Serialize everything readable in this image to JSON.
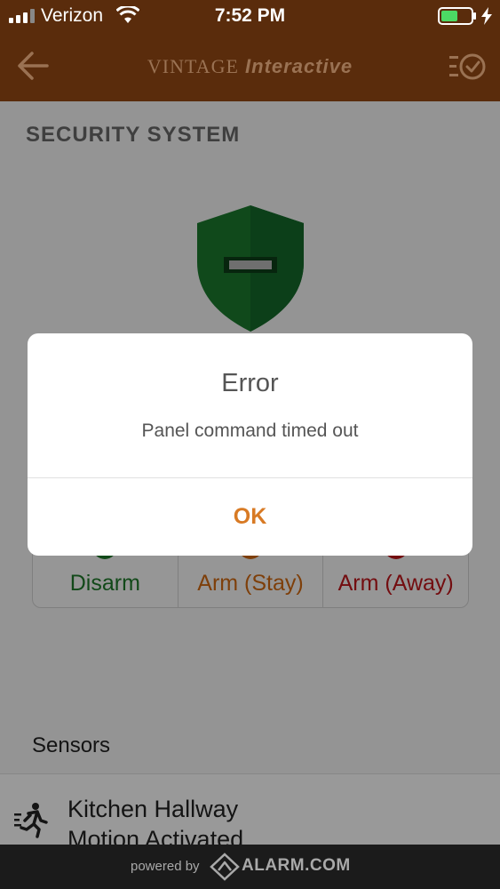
{
  "status_bar": {
    "carrier": "Verizon",
    "time": "7:52 PM",
    "icons": [
      "signal-icon",
      "wifi-icon",
      "battery-icon",
      "charging-bolt-icon"
    ]
  },
  "nav": {
    "back_icon": "back-arrow-icon",
    "brand": "VINTAGE",
    "brand_sub": "Interactive",
    "right_icon": "checklist-icon"
  },
  "page": {
    "section_title": "SECURITY SYSTEM",
    "shield_icon": "shield-disarmed-icon",
    "arm_buttons": {
      "disarm": "Disarm",
      "arm_stay": "Arm (Stay)",
      "arm_away": "Arm (Away)"
    },
    "sensors_label": "Sensors",
    "sensor": {
      "icon": "motion-runner-icon",
      "name": "Kitchen Hallway",
      "status": "Motion Activated"
    }
  },
  "dialog": {
    "title": "Error",
    "message": "Panel command timed out",
    "ok_label": "OK"
  },
  "footer": {
    "powered_by": "powered by",
    "logo_text": "ALARM.COM"
  },
  "colors": {
    "nav_bg": "#5a2c0c",
    "accent_orange": "#d87a24",
    "disarm_green": "#1f7a2a",
    "stay_orange": "#d26a12",
    "away_red": "#c0161b",
    "shield_green": "#0f5a1c"
  }
}
